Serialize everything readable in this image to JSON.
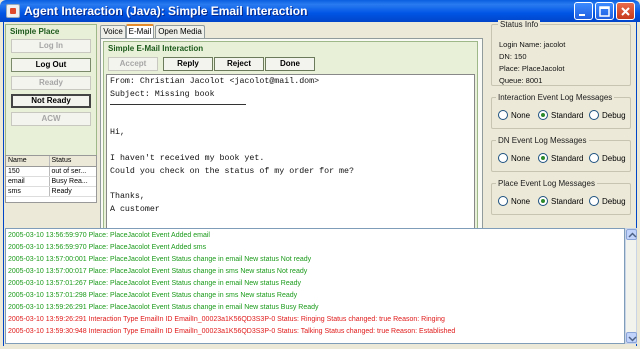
{
  "window": {
    "title": "Agent Interaction (Java): Simple Email Interaction"
  },
  "left": {
    "title": "Simple Place",
    "buttons": [
      "Log In",
      "Log Out",
      "Ready",
      "Not Ready",
      "ACW"
    ],
    "table": {
      "headers": [
        "Name",
        "Status"
      ],
      "rows": [
        [
          "150",
          "out of ser..."
        ],
        [
          "email",
          "Busy Rea..."
        ],
        [
          "sms",
          "Ready"
        ]
      ]
    }
  },
  "tabs": [
    "Voice",
    "E-Mail",
    "Open Media"
  ],
  "email": {
    "title": "Simple E-Mail Interaction",
    "buttons": [
      "Accept",
      "Reply",
      "Reject",
      "Done"
    ],
    "lines": [
      "From: Christian Jacolot <jacolot@mail.dom>",
      "Subject: Missing book",
      "Hi,",
      "I haven't received my book yet.",
      "Could you check on the status of my order for me?",
      "Thanks,",
      "A customer"
    ]
  },
  "status_info": {
    "title": "Status Info",
    "lines": [
      "Login Name: jacolot",
      "DN: 150",
      "Place: PlaceJacolot",
      "Queue: 8001"
    ]
  },
  "log_groups": [
    {
      "title": "Interaction Event Log Messages",
      "selected": "Standard"
    },
    {
      "title": "DN Event Log Messages",
      "selected": "Standard"
    },
    {
      "title": "Place Event Log Messages",
      "selected": "Standard"
    }
  ],
  "radio_labels": [
    "None",
    "Standard",
    "Debug"
  ],
  "log": [
    {
      "color": "green",
      "text": "2005-03-10 13:56:59:970  Place: PlaceJacolot     Event     Added email"
    },
    {
      "color": "green",
      "text": "2005-03-10 13:56:59:970  Place: PlaceJacolot     Event     Added sms"
    },
    {
      "color": "green",
      "text": "2005-03-10 13:57:00:001  Place: PlaceJacolot     Event     Status change in email     New status Not ready"
    },
    {
      "color": "green",
      "text": "2005-03-10 13:57:00:017  Place: PlaceJacolot     Event     Status change in sms     New status Not ready"
    },
    {
      "color": "green",
      "text": "2005-03-10 13:57:01:267  Place: PlaceJacolot     Event     Status change in email     New status Ready"
    },
    {
      "color": "green",
      "text": "2005-03-10 13:57:01:298  Place: PlaceJacolot     Event     Status change in sms     New status Ready"
    },
    {
      "color": "green",
      "text": "2005-03-10 13:59:26:291  Place: PlaceJacolot     Event     Status change in email     New status Busy Ready"
    },
    {
      "color": "red",
      "text": "2005-03-10 13:59:26:291  Interaction  Type EmailIn  ID EmailIn_00023a1K56QD3S3P-0     Status: Ringing     Status changed: true     Reason: Ringing"
    },
    {
      "color": "red",
      "text": "2005-03-10 13:59:30:948  Interaction  Type EmailIn  ID EmailIn_00023a1K56QD3S3P-0     Status: Talking     Status changed: true     Reason: Established"
    }
  ]
}
